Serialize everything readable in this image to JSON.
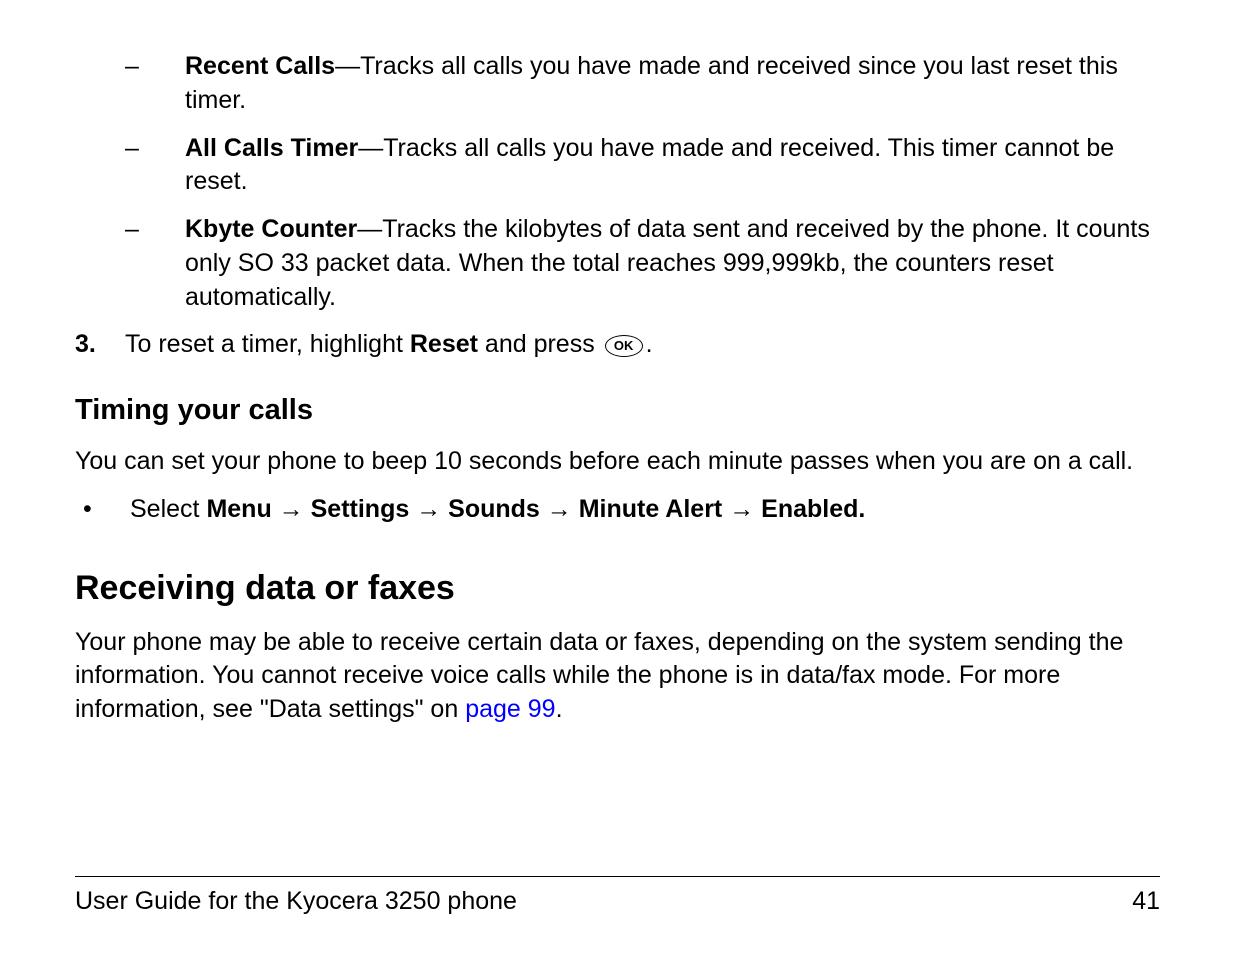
{
  "dashItems": [
    {
      "bold": "Recent Calls",
      "rest": "—Tracks all calls you have made and received since you last reset this timer."
    },
    {
      "bold": "All Calls Timer",
      "rest": "—Tracks all calls you have made and received. This timer cannot be reset."
    },
    {
      "bold": "Kbyte Counter",
      "rest": "—Tracks the kilobytes of data sent and received by the phone. It counts only SO 33 packet data. When the total reaches 999,999kb, the counters reset automatically."
    }
  ],
  "step3": {
    "marker": "3.",
    "prefix": "To reset a timer, highlight ",
    "bold": "Reset",
    "mid": " and press ",
    "okLabel": "OK",
    "suffix": "."
  },
  "heading1": "Timing your calls",
  "para1": "You can set your phone to beep 10 seconds before each minute passes when you are on a call.",
  "bulletItem": {
    "prefix": "Select ",
    "path": [
      "Menu",
      "Settings",
      "Sounds",
      "Minute Alert",
      "Enabled."
    ]
  },
  "heading2": "Receiving data or faxes",
  "para2": {
    "text": "Your phone may be able to receive certain data or faxes, depending on the system sending the information. You cannot receive voice calls while the phone is in data/fax mode. For more information, see \"Data settings\" on ",
    "link": "page 99",
    "suffix": "."
  },
  "footer": {
    "left": "User Guide for the Kyocera 3250 phone",
    "right": "41"
  },
  "dashMarker": "–",
  "bulletMarker": "•",
  "arrow": " → "
}
